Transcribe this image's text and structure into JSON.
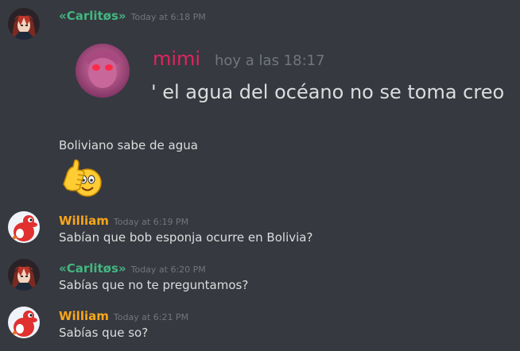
{
  "messages": [
    {
      "author": "«Carlitøs»",
      "author_color": "#43b581",
      "timestamp": "Today at 6:18 PM",
      "avatar_icon": "anime-avatar",
      "quoted": {
        "author": "mimi",
        "author_color": "#e0245e",
        "timestamp": "hoy a las 18:17",
        "text": "' el agua del océano no se toma creo",
        "avatar_icon": "pink-anime-avatar"
      },
      "text": "Boliviano sabe de agua",
      "emoji": "thumbs-up-face-emoji"
    },
    {
      "author": "William",
      "author_color": "#faa61a",
      "timestamp": "Today at 6:19 PM",
      "avatar_icon": "red-yoshi-avatar",
      "text": "Sabían que bob esponja ocurre en Bolivia?"
    },
    {
      "author": "«Carlitøs»",
      "author_color": "#43b581",
      "timestamp": "Today at 6:20 PM",
      "avatar_icon": "anime-avatar",
      "text": "Sabías que no te preguntamos?"
    },
    {
      "author": "William",
      "author_color": "#faa61a",
      "timestamp": "Today at 6:21 PM",
      "avatar_icon": "red-yoshi-avatar",
      "text": "Sabías que so?"
    }
  ]
}
